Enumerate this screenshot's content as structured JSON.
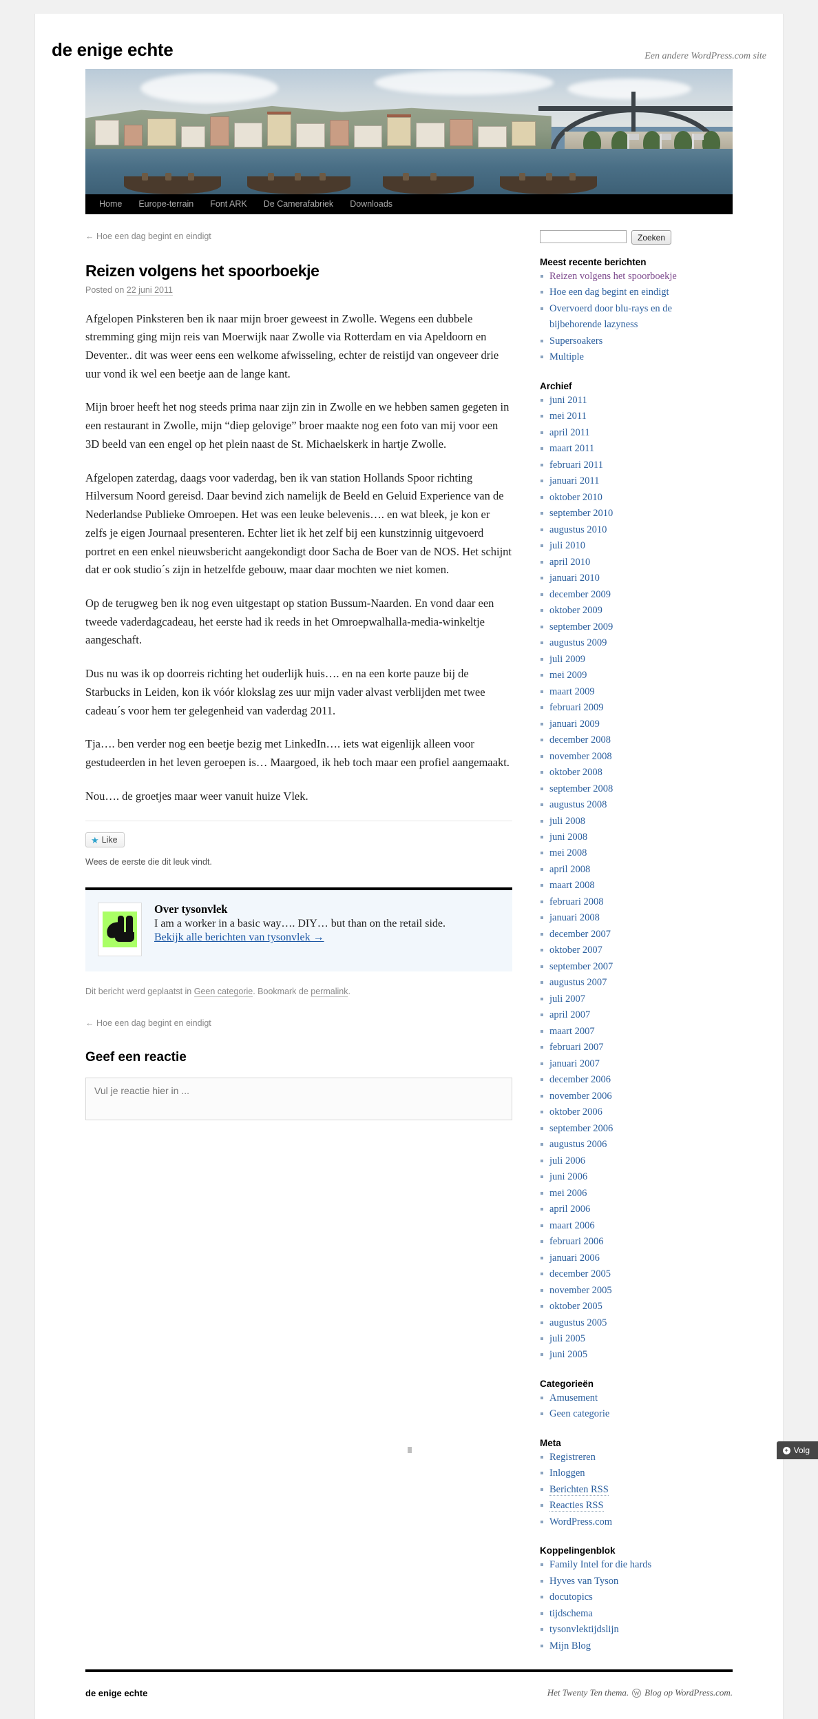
{
  "site": {
    "title": "de enige echte",
    "description": "Een andere WordPress.com site"
  },
  "nav": {
    "items": [
      {
        "label": "Home"
      },
      {
        "label": "Europe-terrain"
      },
      {
        "label": "Font ARK"
      },
      {
        "label": "De Camerafabriek"
      },
      {
        "label": "Downloads"
      }
    ]
  },
  "post": {
    "nav_previous": "← Hoe een dag begint en eindigt",
    "title": "Reizen volgens het spoorboekje",
    "meta_prefix": "Posted on",
    "date": "22 juni 2011",
    "paragraphs": [
      "Afgelopen Pinksteren ben ik naar mijn broer geweest in Zwolle. Wegens een dubbele stremming ging mijn reis van Moerwijk naar Zwolle via Rotterdam en via Apeldoorn en Deventer.. dit was weer eens een welkome afwisseling, echter de reistijd van ongeveer drie uur vond ik wel een beetje aan de lange kant.",
      "Mijn broer heeft het nog steeds prima naar zijn zin in Zwolle en we hebben samen gegeten in een restaurant in Zwolle, mijn “diep gelovige” broer maakte nog een foto van mij voor een 3D beeld van een engel op het plein naast de St. Michaelskerk in hartje Zwolle.",
      "Afgelopen zaterdag, daags voor vaderdag, ben ik van station Hollands Spoor richting Hilversum Noord gereisd. Daar bevind zich namelijk de Beeld en Geluid Experience van de Nederlandse Publieke Omroepen. Het was een leuke belevenis…. en wat bleek, je kon er zelfs je eigen Journaal presenteren. Echter liet ik het zelf bij een kunstzinnig uitgevoerd portret en een enkel nieuwsbericht aangekondigt door Sacha de Boer van de NOS. Het schijnt dat er ook studio´s zijn in hetzelfde gebouw, maar daar mochten we niet komen.",
      "Op de terugweg ben ik nog even uitgestapt op station Bussum-Naarden. En vond daar een tweede vaderdagcadeau, het eerste had ik reeds in het Omroepwalhalla-media-winkeltje aangeschaft.",
      "Dus nu was ik op doorreis richting het ouderlijk huis…. en na een korte pauze bij de Starbucks in Leiden, kon ik vóór klokslag zes uur mijn vader alvast verblijden met twee cadeau´s voor hem ter gelegenheid van vaderdag 2011.",
      "Tja…. ben verder nog een beetje bezig met LinkedIn…. iets wat eigenlijk alleen voor gestudeerden in het leven geroepen is… Maargoed, ik heb toch maar een profiel aangemaakt.",
      "Nou…. de groetjes maar weer vanuit huize Vlek."
    ],
    "like_label": "Like",
    "like_count_text": "Wees de eerste die dit leuk vindt.",
    "utility_before": "Dit bericht werd geplaatst in",
    "utility_category": "Geen categorie",
    "utility_middle": ". Bookmark de",
    "utility_permalink": "permalink",
    "utility_after": "."
  },
  "author_box": {
    "heading": "Over tysonvlek",
    "bio": "I am a worker in a basic way…. DIY… but than on the retail side.",
    "link": "Bekijk alle berichten van tysonvlek →"
  },
  "nav_below": {
    "previous": "← Hoe een dag begint en eindigt"
  },
  "comments": {
    "reply_title": "Geef een reactie",
    "textarea_placeholder": "Vul je reactie hier in ..."
  },
  "sidebar": {
    "search": {
      "value": "",
      "placeholder": "",
      "button_label": "Zoeken"
    },
    "recent_posts": {
      "title": "Meest recente berichten",
      "items": [
        {
          "label": "Reizen volgens het spoorboekje",
          "visited": true
        },
        {
          "label": "Hoe een dag begint en eindigt",
          "visited": false
        },
        {
          "label": "Overvoerd door blu-rays en de bijbehorende lazyness",
          "visited": false
        },
        {
          "label": "Supersoakers",
          "visited": false
        },
        {
          "label": "Multiple",
          "visited": false
        }
      ]
    },
    "archive": {
      "title": "Archief",
      "items": [
        "juni 2011",
        "mei 2011",
        "april 2011",
        "maart 2011",
        "februari 2011",
        "januari 2011",
        "oktober 2010",
        "september 2010",
        "augustus 2010",
        "juli 2010",
        "april 2010",
        "januari 2010",
        "december 2009",
        "oktober 2009",
        "september 2009",
        "augustus 2009",
        "juli 2009",
        "mei 2009",
        "maart 2009",
        "februari 2009",
        "januari 2009",
        "december 2008",
        "november 2008",
        "oktober 2008",
        "september 2008",
        "augustus 2008",
        "juli 2008",
        "juni 2008",
        "mei 2008",
        "april 2008",
        "maart 2008",
        "februari 2008",
        "januari 2008",
        "december 2007",
        "oktober 2007",
        "september 2007",
        "augustus 2007",
        "juli 2007",
        "april 2007",
        "maart 2007",
        "februari 2007",
        "januari 2007",
        "december 2006",
        "november 2006",
        "oktober 2006",
        "september 2006",
        "augustus 2006",
        "juli 2006",
        "juni 2006",
        "mei 2006",
        "april 2006",
        "maart 2006",
        "februari 2006",
        "januari 2006",
        "december 2005",
        "november 2005",
        "oktober 2005",
        "augustus 2005",
        "juli 2005",
        "juni 2005"
      ]
    },
    "categories": {
      "title": "Categorieën",
      "items": [
        "Amusement",
        "Geen categorie"
      ]
    },
    "meta": {
      "title": "Meta",
      "items": [
        {
          "label": "Registreren",
          "abbr": false
        },
        {
          "label": "Inloggen",
          "abbr": false
        },
        {
          "label": "Berichten RSS",
          "abbr": true
        },
        {
          "label": "Reacties RSS",
          "abbr": true
        },
        {
          "label": "WordPress.com",
          "abbr": false
        }
      ]
    },
    "links": {
      "title": "Koppelingenblok",
      "items": [
        "Family Intel for die hards",
        "Hyves van Tyson",
        "docutopics",
        "tijdschema",
        "tysonvlektijdslijn",
        "Mijn Blog"
      ]
    }
  },
  "footer": {
    "site_info": "de enige echte",
    "theme_text": "Het Twenty Ten thema.",
    "wp_badge": "W",
    "blog_text": "Blog op WordPress.com."
  },
  "follow_bar": {
    "label": "Volg",
    "icon": "+"
  }
}
